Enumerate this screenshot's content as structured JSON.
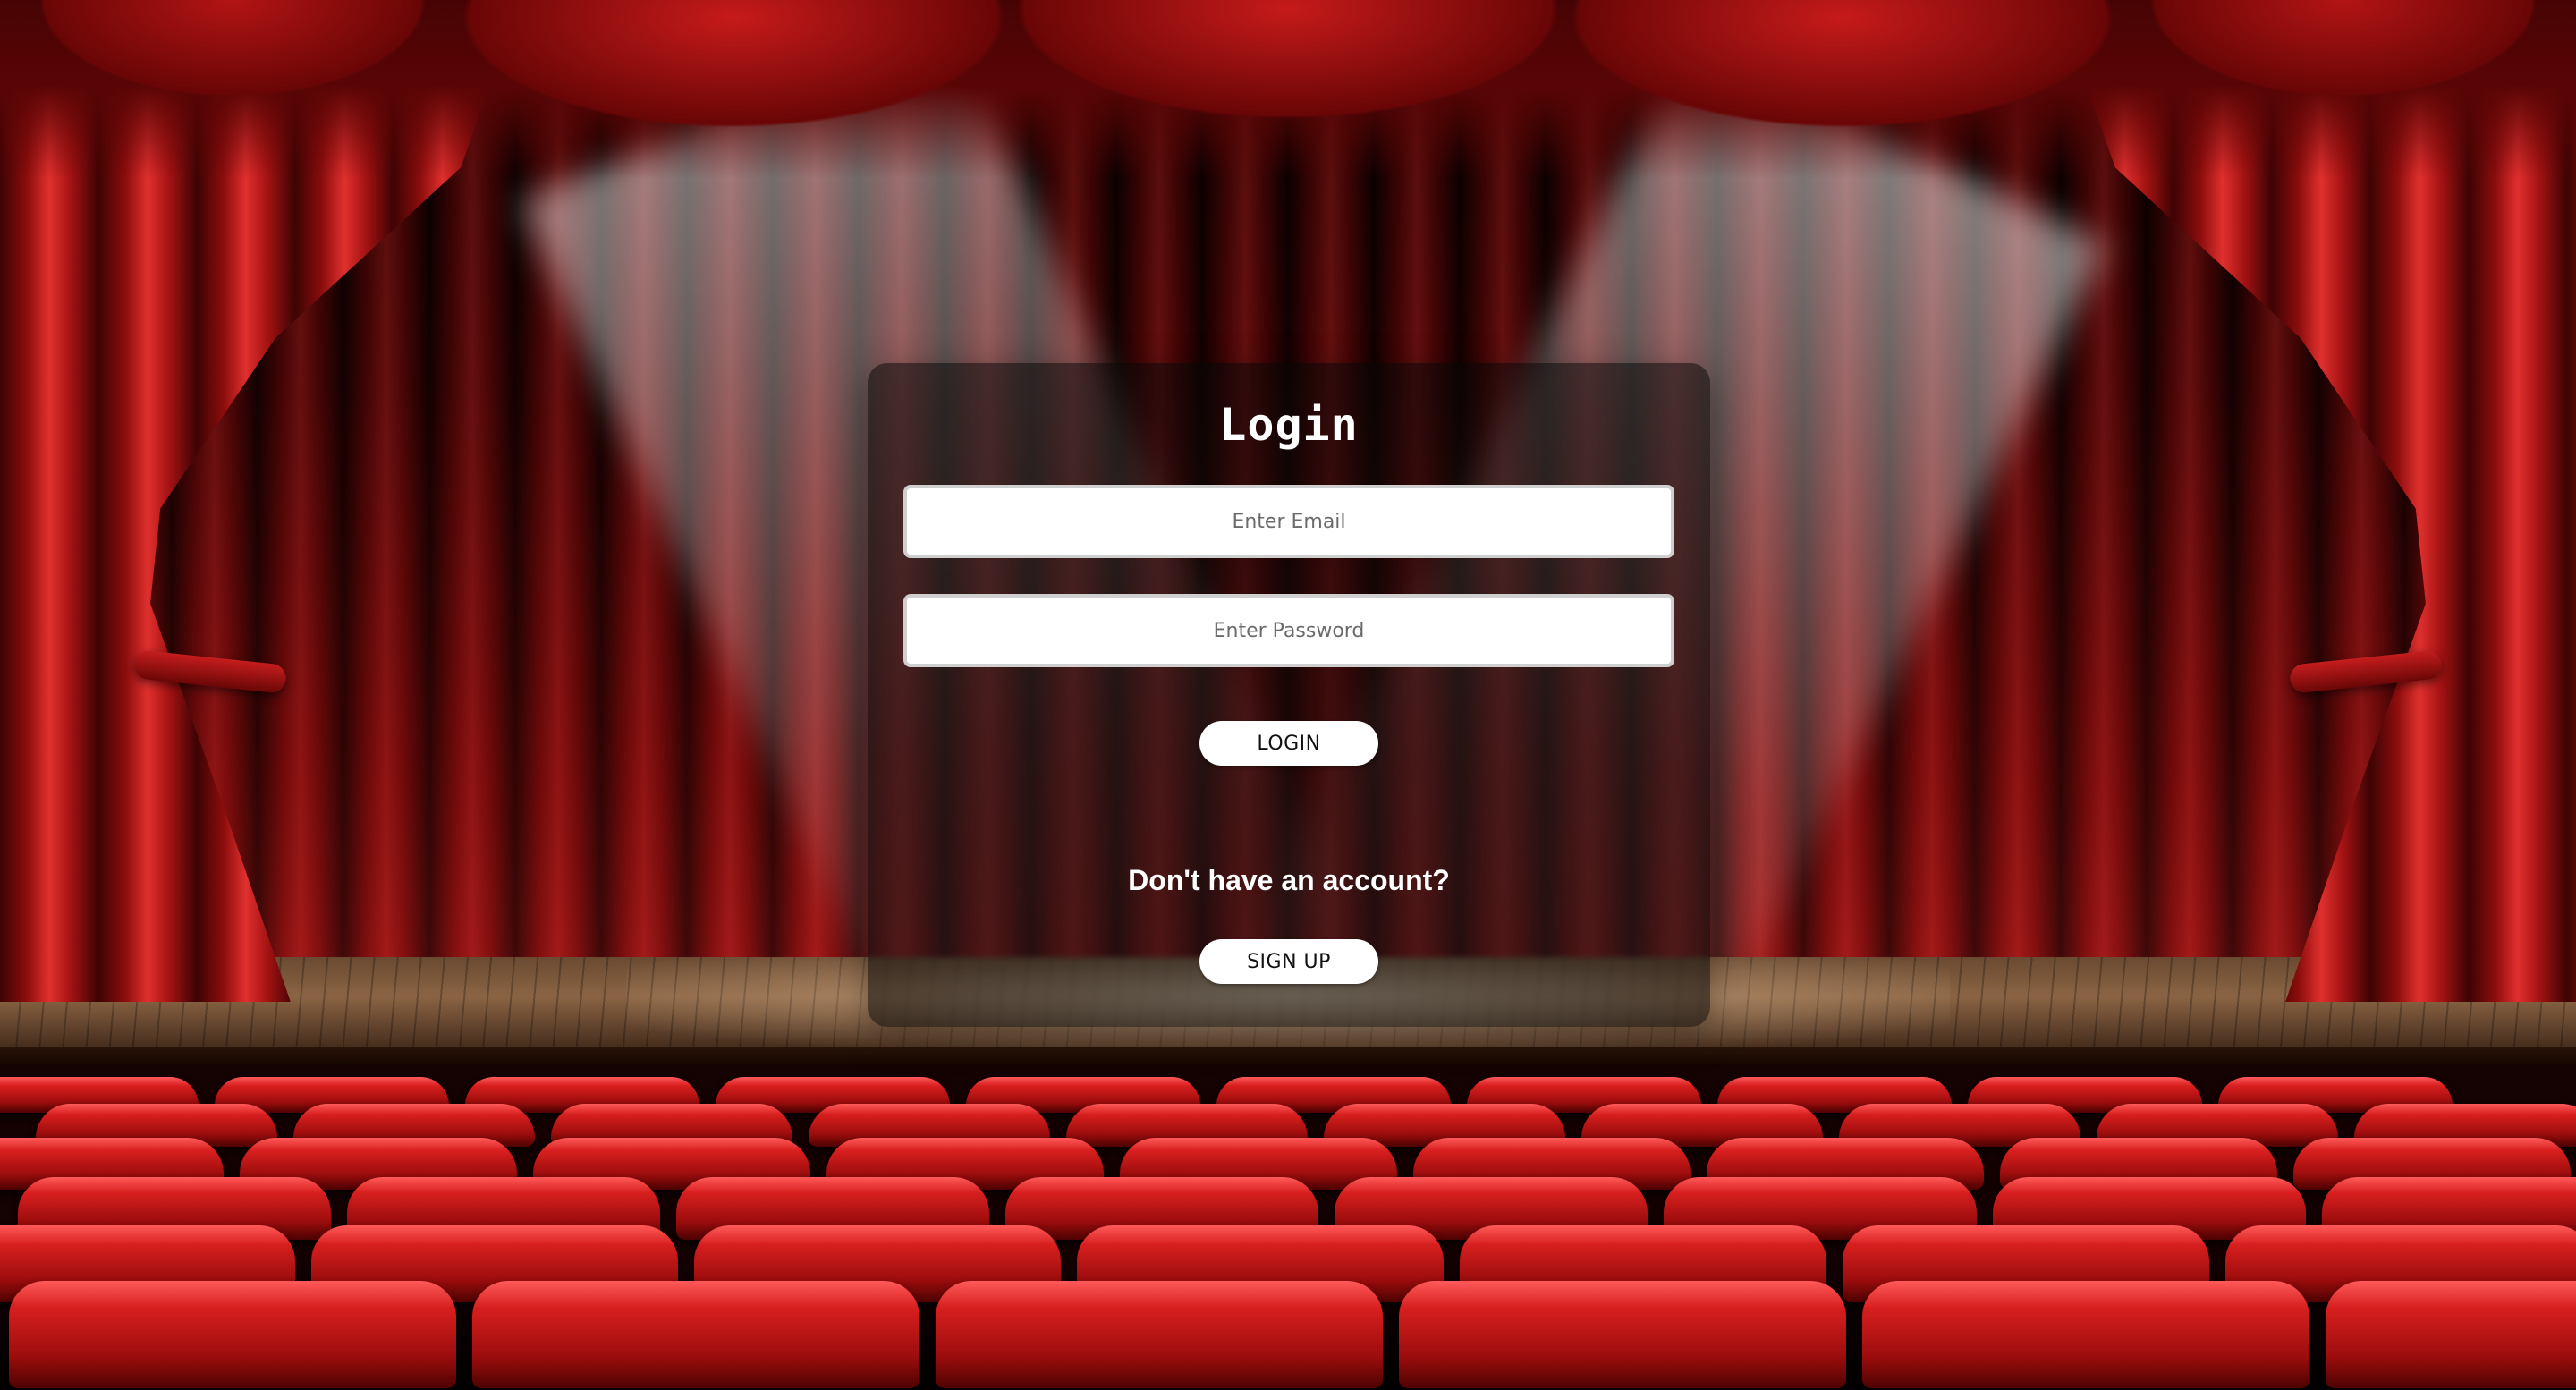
{
  "login": {
    "title": "Login",
    "email_placeholder": "Enter Email",
    "password_placeholder": "Enter Password",
    "login_button": "LOGIN",
    "signup_prompt": "Don't have an account?",
    "signup_button": "SIGN UP"
  },
  "colors": {
    "curtain_red": "#c61a1a",
    "card_background": "rgba(8,8,8,0.55)",
    "button_background": "#ffffff",
    "text_light": "#ffffff"
  }
}
